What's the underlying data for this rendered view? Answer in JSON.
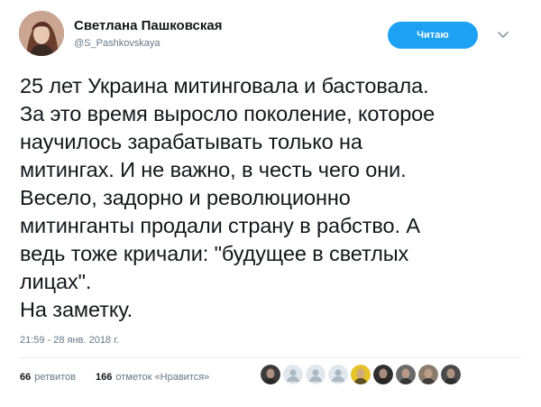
{
  "author": {
    "display_name": "Светлана Пашковская",
    "handle": "@S_Pashkovskaya"
  },
  "follow_button": {
    "label": "Читаю"
  },
  "tweet": {
    "lines": [
      "25 лет Украина митинговала и бастовала.",
      "За это время выросло поколение, которое",
      "научилось зарабатывать только на",
      "митингах. И не важно, в честь чего они.",
      "Весело, задорно и революционно",
      "митинганты продали страну в рабство. А",
      "ведь тоже кричали: \"будущее в светлых",
      "лицах\".",
      "На заметку."
    ],
    "timestamp": "21:59 - 28 янв. 2018 г."
  },
  "stats": {
    "retweets_count": "66",
    "retweets_label": "ретвитов",
    "likes_count": "166",
    "likes_label": "отметок «Нравится»"
  },
  "likers": [
    {
      "icon": "avatar-photo",
      "color": "#3b3b3b"
    },
    {
      "icon": "default-egg-avatar",
      "color": "#aab8c2"
    },
    {
      "icon": "default-egg-avatar",
      "color": "#aab8c2"
    },
    {
      "icon": "default-egg-avatar",
      "color": "#aab8c2"
    },
    {
      "icon": "avatar-photo",
      "color": "#e6c229"
    },
    {
      "icon": "avatar-photo",
      "color": "#2f2f2f"
    },
    {
      "icon": "avatar-photo",
      "color": "#6b6b6b"
    },
    {
      "icon": "avatar-photo",
      "color": "#8a7c6b"
    },
    {
      "icon": "avatar-photo",
      "color": "#4a4a4a"
    }
  ],
  "colors": {
    "accent": "#1da1f2",
    "text": "#14171a",
    "muted": "#657786"
  }
}
